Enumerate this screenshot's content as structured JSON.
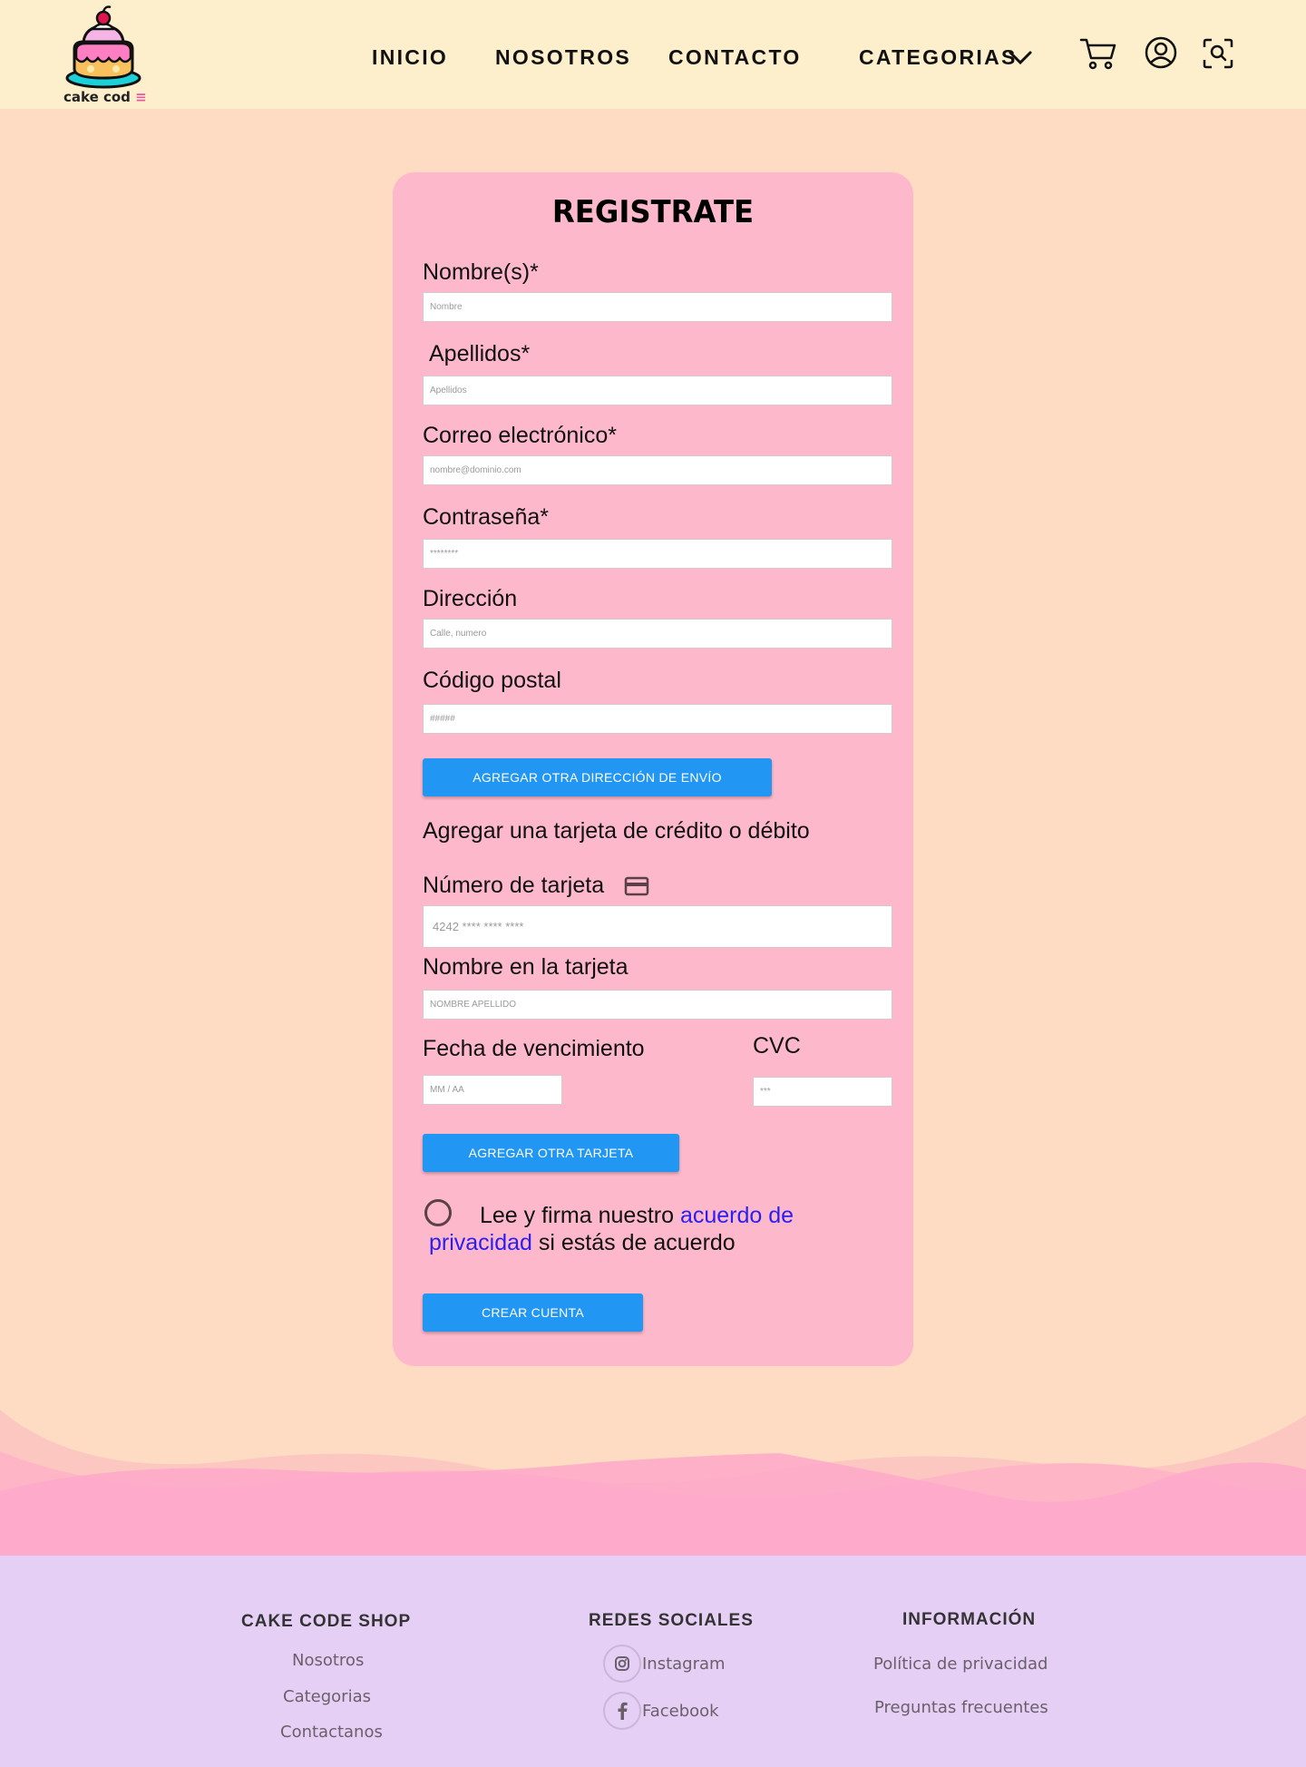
{
  "header": {
    "logo_text": "cake cod",
    "logo_menu_glyph": "≡",
    "nav": [
      "INICIO",
      "NOSOTROS",
      "CONTACTO",
      "CATEGORIAS"
    ],
    "icons": [
      "cart-icon",
      "user-icon",
      "search-icon"
    ]
  },
  "form": {
    "title": "REGISTRATE",
    "name_label": "Nombre(s)*",
    "name_placeholder": "Nombre",
    "lastname_label": "Apellidos*",
    "lastname_placeholder": "Apellidos",
    "email_label": "Correo electrónico*",
    "email_placeholder": "nombre@dominio.com",
    "password_label": "Contraseña*",
    "password_placeholder": "********",
    "address_label": "Dirección",
    "address_placeholder": "Calle, numero",
    "zip_label": "Código postal",
    "zip_placeholder": "#####",
    "add_address_button": "AGREGAR OTRA DIRECCIÓN DE ENVÍO",
    "card_section_title": "Agregar una tarjeta de crédito o débito",
    "card_number_label": "Número de tarjeta",
    "card_number_placeholder": "4242 **** **** ****",
    "card_name_label": "Nombre en la tarjeta",
    "card_name_placeholder": "NOMBRE APELLIDO",
    "expiry_label": "Fecha de vencimiento",
    "expiry_placeholder": "MM / AA",
    "cvc_label": "CVC",
    "cvc_placeholder": "***",
    "add_card_button": "AGREGAR OTRA TARJETA",
    "consent_prefix": "Lee y firma nuestro",
    "consent_link": "acuerdo de privacidad",
    "consent_link_part1": "acuerdo de",
    "consent_link_part2": "privacidad",
    "consent_suffix": "si estás de acuerdo",
    "create_button": "CREAR CUENTA"
  },
  "footer": {
    "col1": {
      "title": "CAKE CODE SHOP",
      "links": [
        "Nosotros",
        "Categorias",
        "Contactanos"
      ]
    },
    "col2": {
      "title": "REDES SOCIALES",
      "links": [
        "Instagram",
        "Facebook"
      ]
    },
    "col3": {
      "title": "INFORMACIÓN",
      "links": [
        "Política de privacidad",
        "Preguntas frecuentes"
      ]
    }
  },
  "colors": {
    "header_bg": "#fdefcb",
    "page_bg": "#fedcc4",
    "card_bg": "#feb8cb",
    "button": "#2196f3",
    "link": "#2a1ff0",
    "footer_bg": "#e6cff5"
  }
}
